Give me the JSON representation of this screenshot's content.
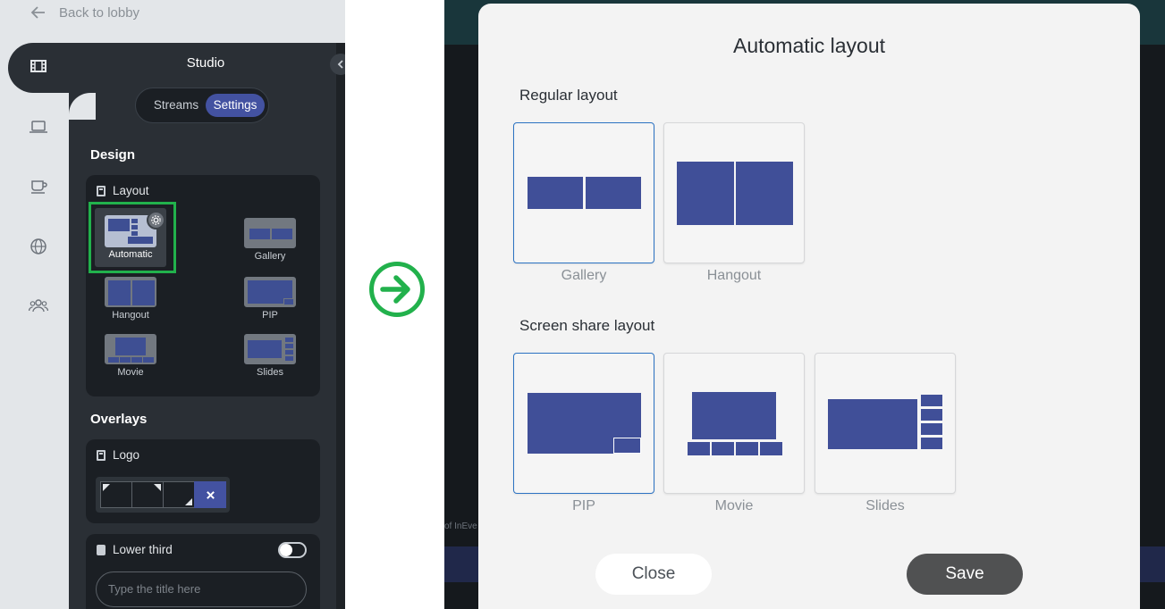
{
  "left_panel": {
    "back_label": "Back to lobby",
    "studio_title": "Studio",
    "tabs": {
      "streams": "Streams",
      "settings": "Settings"
    },
    "design_heading": "Design",
    "layout_card_title": "Layout",
    "layouts": {
      "automatic": "Automatic",
      "gallery": "Gallery",
      "hangout": "Hangout",
      "pip": "PIP",
      "movie": "Movie",
      "slides": "Slides"
    },
    "overlays_heading": "Overlays",
    "logo_card_title": "Logo",
    "lower_third_title": "Lower third",
    "lower_third_placeholder": "Type the title here",
    "sidebar_icons": [
      "film-icon",
      "laptop-icon",
      "coffee-cup-icon",
      "globe-icon",
      "people-icon"
    ]
  },
  "background_text": "of InEve",
  "modal": {
    "title": "Automatic layout",
    "regular_heading": "Regular layout",
    "regular_options": [
      "Gallery",
      "Hangout"
    ],
    "screen_share_heading": "Screen share layout",
    "screen_share_options": [
      "PIP",
      "Movie",
      "Slides"
    ],
    "close_label": "Close",
    "save_label": "Save"
  },
  "colors": {
    "accent": "#4352a1",
    "highlight": "#22b14c",
    "selection_border": "#2b72c2",
    "layout_fill": "#404f98"
  }
}
